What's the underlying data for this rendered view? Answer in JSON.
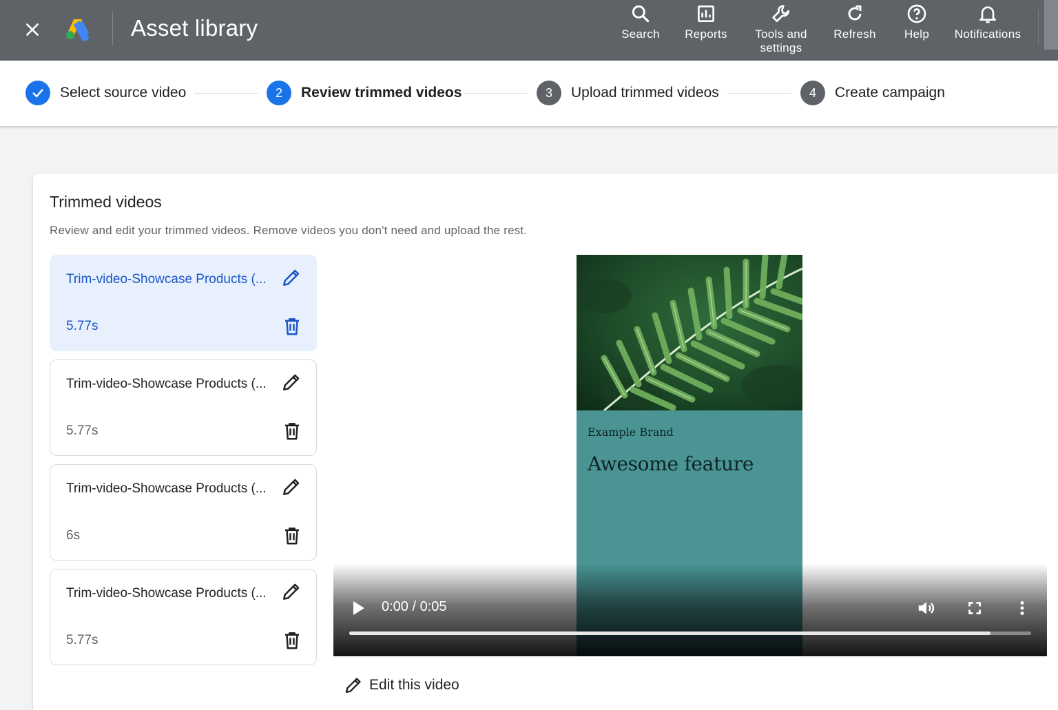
{
  "app": {
    "title": "Asset library"
  },
  "topbar": {
    "actions": [
      {
        "label": "Search",
        "icon": "search-icon"
      },
      {
        "label": "Reports",
        "icon": "reports-icon"
      },
      {
        "label": "Tools and\nsettings",
        "icon": "wrench-icon"
      },
      {
        "label": "Refresh",
        "icon": "refresh-icon"
      },
      {
        "label": "Help",
        "icon": "help-icon"
      },
      {
        "label": "Notifications",
        "icon": "bell-icon"
      }
    ]
  },
  "stepper": {
    "steps": [
      {
        "number": "✓",
        "label": "Select source video",
        "state": "completed"
      },
      {
        "number": "2",
        "label": "Review trimmed videos",
        "state": "active"
      },
      {
        "number": "3",
        "label": "Upload trimmed videos",
        "state": "pending"
      },
      {
        "number": "4",
        "label": "Create campaign",
        "state": "pending"
      }
    ]
  },
  "card": {
    "title": "Trimmed videos",
    "description": "Review and edit your trimmed videos. Remove videos you don't need and upload the rest."
  },
  "videos": [
    {
      "name": "Trim-video-Showcase Products (...",
      "duration": "5.77s",
      "selected": true
    },
    {
      "name": "Trim-video-Showcase Products (...",
      "duration": "5.77s",
      "selected": false
    },
    {
      "name": "Trim-video-Showcase Products (...",
      "duration": "6s",
      "selected": false
    },
    {
      "name": "Trim-video-Showcase Products (...",
      "duration": "5.77s",
      "selected": false
    }
  ],
  "player": {
    "brand": "Example Brand",
    "headline": "Awesome feature",
    "time": "0:00 / 0:05",
    "progress": 0.94
  },
  "edit_link": {
    "label": "Edit this video"
  },
  "colors": {
    "topbar": "#5f6368",
    "accent_blue": "#1a73e8",
    "selected_bg": "#e8f0fe",
    "step_pending": "#5f6368",
    "poster_teal": "#4a9494"
  }
}
